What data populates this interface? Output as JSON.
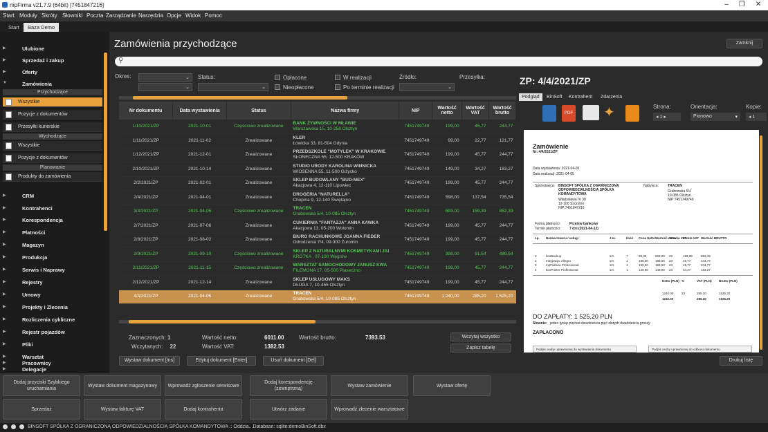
{
  "window": {
    "title": "mpFirma v21.7.9 (64bit) [7451847216]"
  },
  "menu": [
    "Start",
    "Moduły",
    "Skróty",
    "Słowniki",
    "Poczta",
    "Zarządzanie",
    "Narzędzia",
    "Opcje",
    "Widok",
    "Pomoc"
  ],
  "tabs": [
    "Start",
    "Baza Demo"
  ],
  "sidebar": {
    "top": [
      "Ulubione",
      "Sprzedaż i zakup",
      "Oferty",
      "Zamówienia"
    ],
    "h1": "Przychodzące",
    "g1": [
      "Wszystkie",
      "Pozycje z dokumentów",
      "Przesyłki kurierskie"
    ],
    "h2": "Wychodzące",
    "g2": [
      "Wszystkie",
      "Pozycje z dokumentów"
    ],
    "h3": "Planowanie",
    "g3": [
      "Produkty do zamówienia"
    ],
    "rest": [
      "CRM",
      "Kontrahenci",
      "Korespondencja",
      "Płatności",
      "Magazyn",
      "Produkcja",
      "Serwis i Naprawy",
      "Rejestry",
      "Umowy",
      "Projekty i Zlecenia",
      "Rozliczenia cykliczne",
      "Rejestr pojazdów",
      "Pliki",
      "Warsztat",
      "Delegacje",
      "Pracownicy"
    ]
  },
  "main": {
    "title": "Zamówienia przychodzące",
    "close": "Zamknij",
    "filters": {
      "okres": "Okres:",
      "status": "Status:",
      "oplacone": "Opłacone",
      "nieoplacone": "Nieopłacone",
      "wrealizacji": "W realizacji",
      "poterminie": "Po terminie realizacji",
      "zrodlo": "Źródło:",
      "przesylka": "Przesyłka:"
    },
    "columns": [
      "Nr dokumentu",
      "Data wystawienia",
      "Status",
      "Nazwa firmy",
      "NIP",
      "Wartość netto",
      "Wartość VAT",
      "Wartość brutto"
    ],
    "rows": [
      {
        "nr": "1/10/2021/ZP",
        "data": "2021-10-01",
        "status": "Częściowo zrealizowane",
        "firma": "BANK ŻYWNOŚCI W MŁAWIE",
        "adres": "Warszawska 15, 10-258 Olsztyn",
        "nip": "7451749749",
        "netto": "199,00",
        "vat": "45,77",
        "brutto": "244,77",
        "cls": "g"
      },
      {
        "nr": "1/11/2021/ZP",
        "data": "2021-11-02",
        "status": "Zrealizowane",
        "firma": "KLER",
        "adres": "Łowicka 33, 81-504 Gdynia",
        "nip": "7451749749",
        "netto": "99,00",
        "vat": "22,77",
        "brutto": "121,77",
        "cls": ""
      },
      {
        "nr": "1/12/2021/ZP",
        "data": "2021-12-01",
        "status": "Zrealizowane",
        "firma": "PRZEDSZKOLE \"MOTYLEK\" W KRAKOWIE",
        "adres": "SŁONECZNA 55, 12-500 KRAKÓW",
        "nip": "7451749749",
        "netto": "199,00",
        "vat": "45,77",
        "brutto": "244,77",
        "cls": ""
      },
      {
        "nr": "2/10/2021/ZP",
        "data": "2021-10-14",
        "status": "Zrealizowane",
        "firma": "STUDIO URODY KAROLINA WINNICKA",
        "adres": "WIOSENNA 55, 11-500 Giżycko",
        "nip": "7451749749",
        "netto": "149,00",
        "vat": "34,27",
        "brutto": "183,27",
        "cls": ""
      },
      {
        "nr": "2/2/2021/ZP",
        "data": "2021-02-01",
        "status": "Zrealizowane",
        "firma": "SKLEP BUDOWLANY \"BUD-MEX\"",
        "adres": "Akacjowa 4, 12-110 Lipowiec",
        "nip": "7451749749",
        "netto": "199,00",
        "vat": "45,77",
        "brutto": "244,77",
        "cls": ""
      },
      {
        "nr": "2/4/2021/ZP",
        "data": "2021-04-01",
        "status": "Zrealizowane",
        "firma": "DROGERIA \"NATURELLA\"",
        "adres": "Chopina 9, 12-140 Świętajno",
        "nip": "7451749749",
        "netto": "598,00",
        "vat": "137,54",
        "brutto": "735,54",
        "cls": ""
      },
      {
        "nr": "3/4/2021/ZP",
        "data": "2021-04-05",
        "status": "Częściowo zrealizowane",
        "firma": "TRACEN",
        "adres": "Grabowska 5/4, 10-085 Olsztyn",
        "nip": "7451749749",
        "netto": "693,00",
        "vat": "159,39",
        "brutto": "852,39",
        "cls": "g"
      },
      {
        "nr": "2/7/2021/ZP",
        "data": "2021-07-06",
        "status": "Zrealizowane",
        "firma": "CUKIERNIA \"FANTAZJA\" ANNA KAWKA",
        "adres": "Akacjowa 13, 05-200 Wołomin",
        "nip": "7451749749",
        "netto": "199,00",
        "vat": "45,77",
        "brutto": "244,77",
        "cls": ""
      },
      {
        "nr": "2/8/2021/ZP",
        "data": "2021-08-02",
        "status": "Zrealizowane",
        "firma": "BIURO RACHUNKOWE JOANNA FIEDER",
        "adres": "Odrodzenia 7/4, 09-300 Żuromin",
        "nip": "7451749749",
        "netto": "199,00",
        "vat": "45,77",
        "brutto": "244,77",
        "cls": ""
      },
      {
        "nr": "2/9/2021/ZP",
        "data": "2021-09-10",
        "status": "Częściowo zrealizowane",
        "firma": "SKLEP Z NATURALNYMI KOSMETYKAMI JAI",
        "adres": "KRÓTKA , 07-100 Węgrów",
        "nip": "7451749749",
        "netto": "398,00",
        "vat": "91,54",
        "brutto": "489,54",
        "cls": "g"
      },
      {
        "nr": "2/11/2021/ZP",
        "data": "2021-11-15",
        "status": "Częściowo zrealizowane",
        "firma": "WARSZTAT SAMOCHODOWY JANUSZ KWA",
        "adres": "FILEMONA 17, 05-500 Piaseczno",
        "nip": "7451749749",
        "netto": "199,00",
        "vat": "45,77",
        "brutto": "244,77",
        "cls": "g"
      },
      {
        "nr": "2/12/2021/ZP",
        "data": "2021-12-14",
        "status": "Zrealizowane",
        "firma": "SKLEP USŁUGOWY MAKS",
        "adres": "DŁUGA 7, 10-455 Olsztyn",
        "nip": "7451749749",
        "netto": "199,00",
        "vat": "45,77",
        "brutto": "244,77",
        "cls": ""
      },
      {
        "nr": "4/4/2021/ZP",
        "data": "2021-04-05",
        "status": "Zrealizowane",
        "firma": "TRACEN",
        "adres": "Grabowska 5/4, 10-085 Olsztyn",
        "nip": "7451749749",
        "netto": "1 240,00",
        "vat": "285,20",
        "brutto": "1 525,20",
        "cls": "sel"
      }
    ],
    "summary": {
      "zazn_l": "Zaznaczonych:",
      "zazn": "1",
      "wczyt_l": "Wczytanych:",
      "wczyt": "22",
      "netto_l": "Wartość netto:",
      "netto": "6011.00",
      "vat_l": "Wartość VAT:",
      "vat": "1382.53",
      "brutto_l": "Wartość brutto:",
      "brutto": "7393.53"
    },
    "buttons": {
      "load": "Wczytaj wszystko",
      "save": "Zapisz tabelę",
      "issue": "Wystaw dokument [Ins]",
      "edit": "Edytuj dokument [Enter]",
      "del": "Usuń dokument [Del]",
      "print": "Drukuj listę"
    }
  },
  "right": {
    "title": "ZP: 4/4/2021/ZP",
    "tabs": [
      "Podgląd",
      "BinSoft",
      "Kontrahent",
      "Zdarzenia"
    ],
    "strona": "Strona:",
    "orientacja": "Orientacja:",
    "kopie": "Kopie:",
    "page": "1",
    "orient": "Pionowo",
    "copies": "1"
  },
  "doc": {
    "h": "Zamówienie",
    "nr": "Nr: 4/4/2021/ZP",
    "d1": "Data wystawienia: 2021-04-05",
    "d2": "Data realizacji: 2021-04-05",
    "sp_l": "Sprzedawca:",
    "sp1": "BINSOFT SPÓŁKA Z OGRANICZONĄ",
    "sp2": "ODPOWIEDZIALNOŚCIĄ SPÓŁKA",
    "sp3": "KOMANDYTOWA",
    "sp4": "Władysława IV 38",
    "sp5": "12-100 Szczytno",
    "sp6": "NIP:7451847216",
    "nb_l": "Nabywca:",
    "nb1": "TRACEN",
    "nb2": "Grabowska 5/4",
    "nb3": "10-085 Olsztyn",
    "nb4": "NIP:7451749749",
    "fp_l": "Forma płatności:",
    "fp": "Przelew bankowy",
    "tp_l": "Termin płatności:",
    "tp": "7 dni (2021-04-12)",
    "cols": [
      "Lp.",
      "Nazwa towaru / usługi",
      "J.m.",
      "Ilość",
      "Cena Netto",
      "Wartość netto",
      "Stawka VAT",
      "Kwota VAT",
      "Wartość BRUTTO"
    ],
    "items": [
      [
        "1",
        "boxBackup",
        "szt.",
        "7",
        "99,00",
        "693,00",
        "23",
        "159,39",
        "852,39"
      ],
      [
        "2",
        "Integracja: Allegro",
        "szt.",
        "1",
        "199,00",
        "199,00",
        "23",
        "45,77",
        "244,77"
      ],
      [
        "3",
        "mpFaktura Professional",
        "szt.",
        "1",
        "199,00",
        "199,00",
        "23",
        "45,77",
        "244,77"
      ],
      [
        "4",
        "boxPrinter Professional",
        "szt.",
        "1",
        "149,00",
        "149,00",
        "23",
        "34,27",
        "183,27"
      ]
    ],
    "sum_h": [
      "Netto (PLN)",
      "%",
      "VAT (PLN)",
      "Brutto (PLN)"
    ],
    "sum1": [
      "1240.00",
      "23",
      "285.20",
      "1525.20"
    ],
    "sum2": [
      "1240.00",
      "",
      "285.20",
      "1525.20"
    ],
    "pay": "DO ZAPŁATY: 1 525,20 PLN",
    "slownie_l": "Słownie:",
    "slownie": "jeden tysiąc pięćset dwadzieścia pięć złotych dwadzieścia groszy",
    "paid": "ZAPŁACONO",
    "sig1": "Podpis osoby uprawnionej do wystawienia dokumentu",
    "sig2": "Podpis osoby uprawnionej do odbioru dokumentu"
  },
  "bottom": [
    "Dodaj przyciski Szybkiego uruchamiania",
    "Wystaw dokument magazynowy",
    "Wprowadź zgłoszenie serwisowe",
    "Dodaj korespondencję (zewnętrzną)",
    "Wystaw zamówienie",
    "Wystaw ofertę",
    "Sprzedaż",
    "Wystaw fakturę VAT",
    "Dodaj kontrahenta",
    "Utwórz zadanie",
    "Wprowadź zlecenie warsztatowe"
  ],
  "status": "BINSOFT SPÓŁKA Z OGRANICZONĄ ODPOWIEDZIALNOŚCIĄ SPÓŁKA KOMANDYTOWA :: Oddzia...Database: sqlite:demoBinSoft.dbx"
}
